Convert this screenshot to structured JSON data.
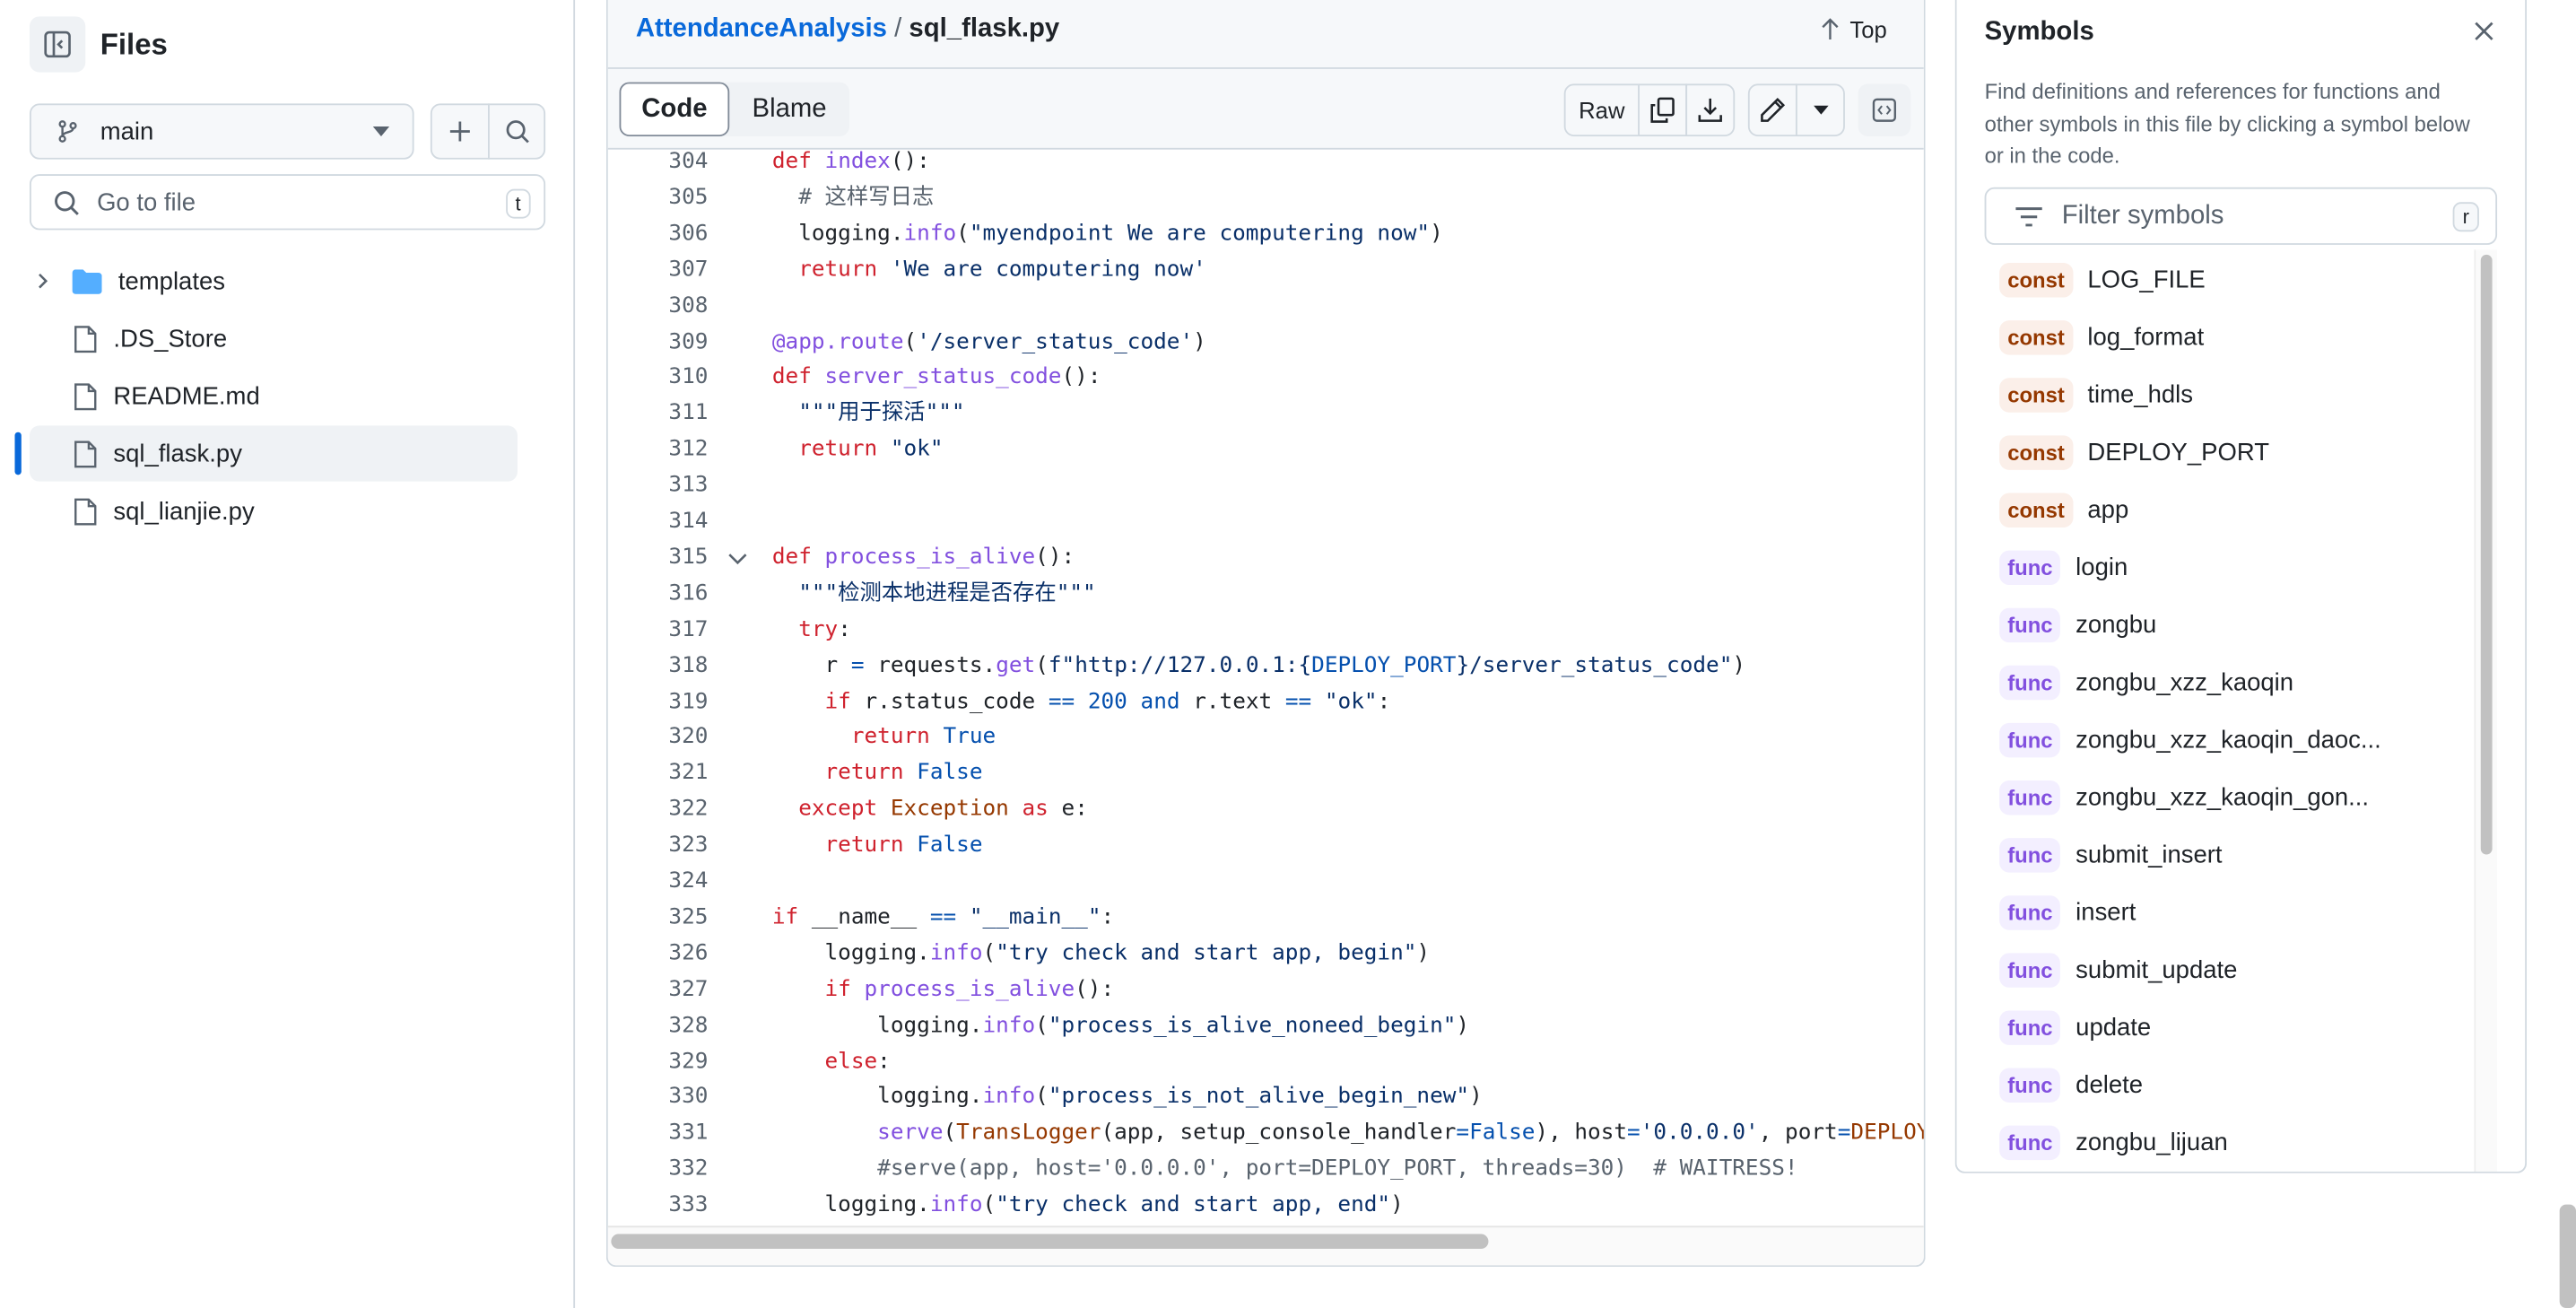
{
  "sidebar": {
    "title": "Files",
    "branch": "main",
    "search_placeholder": "Go to file",
    "search_shortcut": "t",
    "items": [
      {
        "label": "templates",
        "type": "folder"
      },
      {
        "label": ".DS_Store",
        "type": "file"
      },
      {
        "label": "README.md",
        "type": "file"
      },
      {
        "label": "sql_flask.py",
        "type": "file",
        "selected": true
      },
      {
        "label": "sql_lianjie.py",
        "type": "file"
      }
    ]
  },
  "header": {
    "repo": "AttendanceAnalysis",
    "sep": "/",
    "file": "sql_flask.py",
    "top_label": "Top"
  },
  "toolbar": {
    "code_tab": "Code",
    "blame_tab": "Blame",
    "raw_label": "Raw"
  },
  "code": [
    {
      "n": "304",
      "t": [
        [
          "k",
          "def "
        ],
        [
          "f",
          "index"
        ],
        [
          "n",
          "():"
        ]
      ]
    },
    {
      "n": "305",
      "t": [
        [
          "m",
          "  # 这样写日志"
        ]
      ]
    },
    {
      "n": "306",
      "t": [
        [
          "n",
          "  logging."
        ],
        [
          "f",
          "info"
        ],
        [
          "n",
          "("
        ],
        [
          "s",
          "\"myendpoint We are computering now\""
        ],
        [
          "n",
          ")"
        ]
      ]
    },
    {
      "n": "307",
      "t": [
        [
          "k",
          "  return "
        ],
        [
          "s",
          "'We are computering now'"
        ]
      ]
    },
    {
      "n": "308",
      "t": []
    },
    {
      "n": "309",
      "t": [
        [
          "f",
          "@app.route"
        ],
        [
          "n",
          "("
        ],
        [
          "s",
          "'/server_status_code'"
        ],
        [
          "n",
          ")"
        ]
      ]
    },
    {
      "n": "310",
      "t": [
        [
          "k",
          "def "
        ],
        [
          "f",
          "server_status_code"
        ],
        [
          "n",
          "():"
        ]
      ]
    },
    {
      "n": "311",
      "t": [
        [
          "s",
          "  \"\"\"用于探活\"\"\""
        ]
      ]
    },
    {
      "n": "312",
      "t": [
        [
          "k",
          "  return "
        ],
        [
          "s",
          "\"ok\""
        ]
      ]
    },
    {
      "n": "313",
      "t": []
    },
    {
      "n": "314",
      "t": []
    },
    {
      "n": "315",
      "fold": true,
      "t": [
        [
          "k",
          "def "
        ],
        [
          "f",
          "process_is_alive"
        ],
        [
          "n",
          "():"
        ]
      ]
    },
    {
      "n": "316",
      "t": [
        [
          "s",
          "  \"\"\"检测本地进程是否存在\"\"\""
        ]
      ]
    },
    {
      "n": "317",
      "t": [
        [
          "k",
          "  try"
        ],
        [
          "n",
          ":"
        ]
      ]
    },
    {
      "n": "318",
      "t": [
        [
          "n",
          "    r "
        ],
        [
          "c",
          "="
        ],
        [
          "n",
          " requests."
        ],
        [
          "f",
          "get"
        ],
        [
          "n",
          "("
        ],
        [
          "s",
          "f\"http://127.0.0.1:{"
        ],
        [
          "c",
          "DEPLOY_PORT"
        ],
        [
          "s",
          "}/server_status_code\""
        ],
        [
          "n",
          ")"
        ]
      ]
    },
    {
      "n": "319",
      "t": [
        [
          "k",
          "    if"
        ],
        [
          "n",
          " r.status_code "
        ],
        [
          "c",
          "=="
        ],
        [
          "n",
          " "
        ],
        [
          "c",
          "200"
        ],
        [
          "n",
          " "
        ],
        [
          "c",
          "and"
        ],
        [
          "n",
          " r.text "
        ],
        [
          "c",
          "=="
        ],
        [
          "n",
          " "
        ],
        [
          "s",
          "\"ok\""
        ],
        [
          "n",
          ":"
        ]
      ]
    },
    {
      "n": "320",
      "t": [
        [
          "k",
          "      return "
        ],
        [
          "c",
          "True"
        ]
      ]
    },
    {
      "n": "321",
      "t": [
        [
          "k",
          "    return "
        ],
        [
          "c",
          "False"
        ]
      ]
    },
    {
      "n": "322",
      "t": [
        [
          "k",
          "  except "
        ],
        [
          "e",
          "Exception"
        ],
        [
          "k",
          " as"
        ],
        [
          "n",
          " e:"
        ]
      ]
    },
    {
      "n": "323",
      "t": [
        [
          "k",
          "    return "
        ],
        [
          "c",
          "False"
        ]
      ]
    },
    {
      "n": "324",
      "t": []
    },
    {
      "n": "325",
      "t": [
        [
          "k",
          "if"
        ],
        [
          "n",
          " __name__ "
        ],
        [
          "c",
          "=="
        ],
        [
          "n",
          " "
        ],
        [
          "s",
          "\"__main__\""
        ],
        [
          "n",
          ":"
        ]
      ]
    },
    {
      "n": "326",
      "t": [
        [
          "n",
          "    logging."
        ],
        [
          "f",
          "info"
        ],
        [
          "n",
          "("
        ],
        [
          "s",
          "\"try check and start app, begin\""
        ],
        [
          "n",
          ")"
        ]
      ]
    },
    {
      "n": "327",
      "t": [
        [
          "k",
          "    if "
        ],
        [
          "f",
          "process_is_alive"
        ],
        [
          "n",
          "():"
        ]
      ]
    },
    {
      "n": "328",
      "t": [
        [
          "n",
          "        logging."
        ],
        [
          "f",
          "info"
        ],
        [
          "n",
          "("
        ],
        [
          "s",
          "\"process_is_alive_noneed_begin\""
        ],
        [
          "n",
          ")"
        ]
      ]
    },
    {
      "n": "329",
      "t": [
        [
          "k",
          "    else"
        ],
        [
          "n",
          ":"
        ]
      ]
    },
    {
      "n": "330",
      "t": [
        [
          "n",
          "        logging."
        ],
        [
          "f",
          "info"
        ],
        [
          "n",
          "("
        ],
        [
          "s",
          "\"process_is_not_alive_begin_new\""
        ],
        [
          "n",
          ")"
        ]
      ]
    },
    {
      "n": "331",
      "t": [
        [
          "f",
          "        serve"
        ],
        [
          "n",
          "("
        ],
        [
          "e",
          "TransLogger"
        ],
        [
          "n",
          "(app, setup_console_handler"
        ],
        [
          "c",
          "="
        ],
        [
          "c",
          "False"
        ],
        [
          "n",
          "), host"
        ],
        [
          "c",
          "="
        ],
        [
          "s",
          "'0.0.0.0'"
        ],
        [
          "n",
          ", port"
        ],
        [
          "c",
          "="
        ],
        [
          "e",
          "DEPLOY_"
        ]
      ]
    },
    {
      "n": "332",
      "t": [
        [
          "m",
          "        #serve(app, host='0.0.0.0', port=DEPLOY_PORT, threads=30)  # WAITRESS!"
        ]
      ]
    },
    {
      "n": "333",
      "t": [
        [
          "n",
          "    logging."
        ],
        [
          "f",
          "info"
        ],
        [
          "n",
          "("
        ],
        [
          "s",
          "\"try check and start app, end\""
        ],
        [
          "n",
          ")"
        ]
      ]
    }
  ],
  "symbols": {
    "title": "Symbols",
    "description": "Find definitions and references for functions and other symbols in this file by clicking a symbol below or in the code.",
    "filter_placeholder": "Filter symbols",
    "filter_shortcut": "r",
    "items": [
      {
        "kind": "const",
        "name": "LOG_FILE"
      },
      {
        "kind": "const",
        "name": "log_format"
      },
      {
        "kind": "const",
        "name": "time_hdls"
      },
      {
        "kind": "const",
        "name": "DEPLOY_PORT"
      },
      {
        "kind": "const",
        "name": "app"
      },
      {
        "kind": "func",
        "name": "login"
      },
      {
        "kind": "func",
        "name": "zongbu"
      },
      {
        "kind": "func",
        "name": "zongbu_xzz_kaoqin"
      },
      {
        "kind": "func",
        "name": "zongbu_xzz_kaoqin_daoc..."
      },
      {
        "kind": "func",
        "name": "zongbu_xzz_kaoqin_gon..."
      },
      {
        "kind": "func",
        "name": "submit_insert"
      },
      {
        "kind": "func",
        "name": "insert"
      },
      {
        "kind": "func",
        "name": "submit_update"
      },
      {
        "kind": "func",
        "name": "update"
      },
      {
        "kind": "func",
        "name": "delete"
      },
      {
        "kind": "func",
        "name": "zongbu_lijuan"
      }
    ]
  },
  "colors": {
    "accent": "#0969da",
    "link": "#0969da",
    "selected_bar": "#0969da",
    "const_badge": "#953800",
    "func_badge": "#8250df"
  }
}
